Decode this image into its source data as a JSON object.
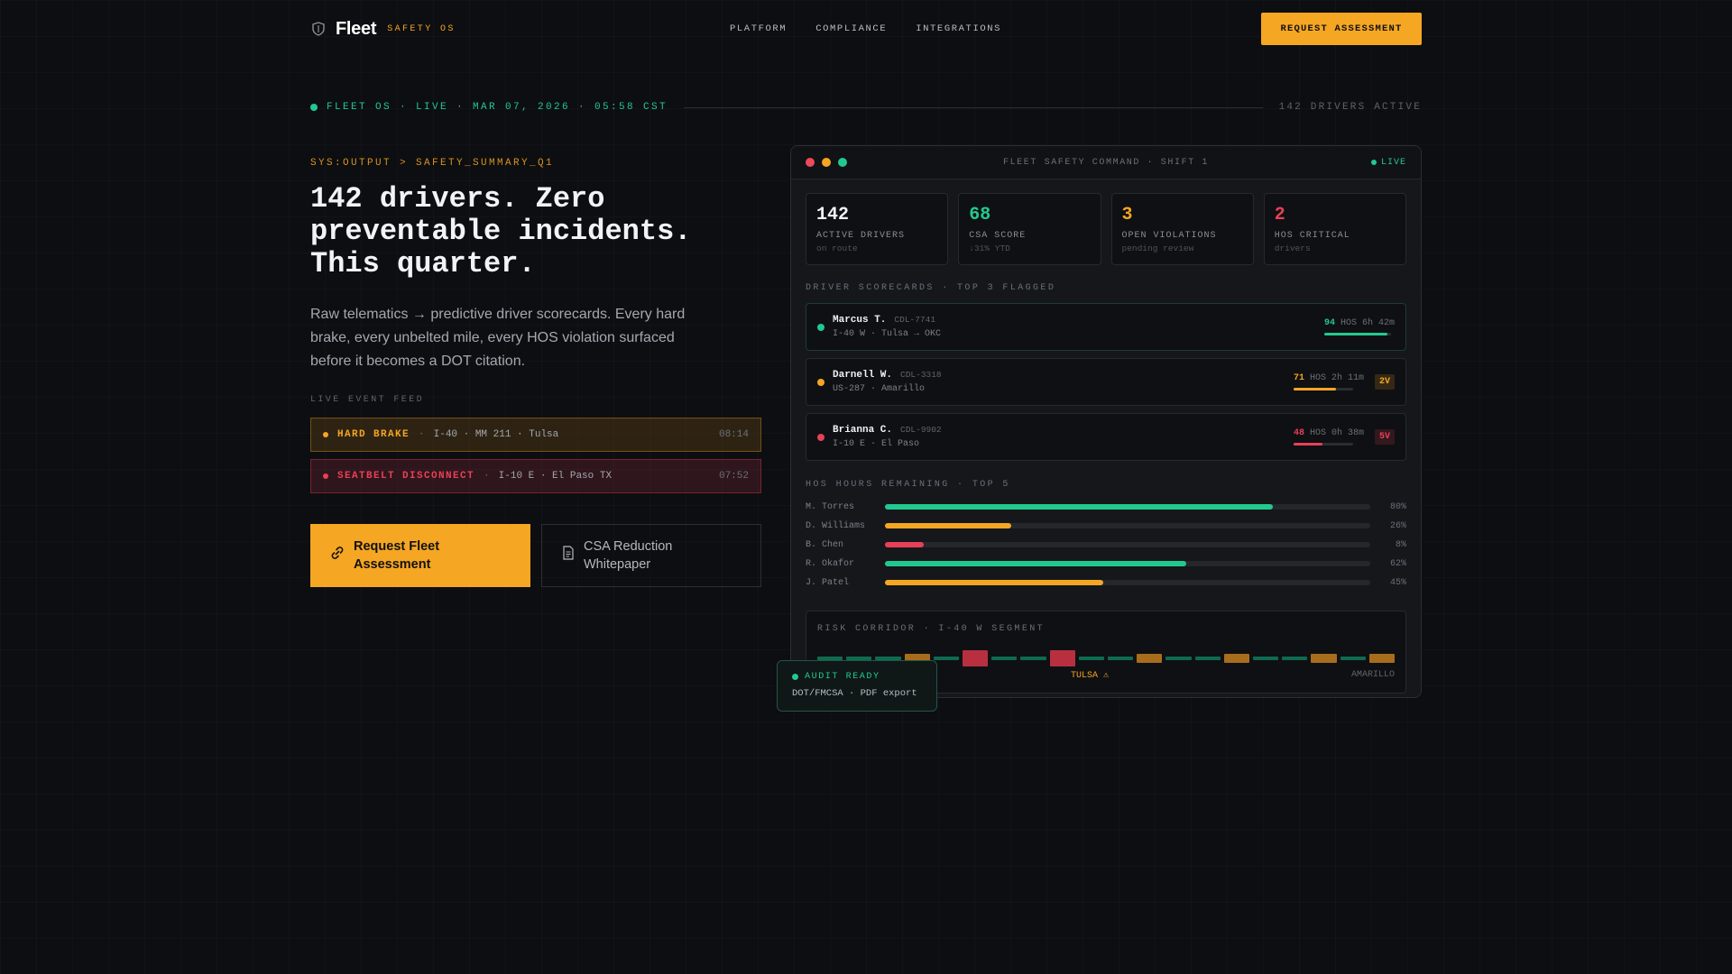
{
  "brand": {
    "name": "Fleet",
    "tagline": "SAFETY OS",
    "icon": "shield-icon"
  },
  "nav": {
    "links": [
      "PLATFORM",
      "COMPLIANCE",
      "INTEGRATIONS"
    ],
    "cta_label": "REQUEST ASSESSMENT"
  },
  "status": {
    "text": "FLEET OS · LIVE · MAR 07, 2026 · 05:58 CST",
    "right": "142 DRIVERS ACTIVE"
  },
  "hero": {
    "eyebrow": "SYS:OUTPUT > SAFETY_SUMMARY_Q1",
    "headline": "142 drivers. Zero preventable incidents. This quarter.",
    "lead": "Raw telematics → predictive driver scorecards. Every hard brake, every unbelted mile, every HOS violation surfaced before it becomes a DOT citation.",
    "feed_label": "LIVE EVENT FEED",
    "feed": [
      {
        "type": "HARD BRAKE",
        "location": "I-40 · MM 211 · Tulsa",
        "time": "08:14",
        "color": "#f5a623"
      },
      {
        "type": "SEATBELT DISCONNECT",
        "location": "I-10 E · El Paso TX",
        "time": "07:52",
        "color": "#e84057"
      }
    ],
    "cta_primary": "Request Fleet Assessment",
    "cta_secondary": "CSA Reduction Whitepaper"
  },
  "dashboard": {
    "title": "FLEET SAFETY COMMAND · SHIFT 1",
    "live": "LIVE",
    "kpis": [
      {
        "value": "142",
        "label": "ACTIVE DRIVERS",
        "sub": "on route",
        "color": "#f2f3f5"
      },
      {
        "value": "68",
        "label": "CSA SCORE",
        "sub": "↓31% YTD",
        "color": "#22c98f"
      },
      {
        "value": "3",
        "label": "OPEN VIOLATIONS",
        "sub": "pending review",
        "color": "#f5a623"
      },
      {
        "value": "2",
        "label": "HOS CRITICAL",
        "sub": "drivers",
        "color": "#e84057"
      }
    ],
    "scorecards_title": "DRIVER SCORECARDS · TOP 3 FLAGGED",
    "drivers": [
      {
        "name": "Marcus T.",
        "cdl": "CDL-7741",
        "route": "I-40 W · Tulsa → OKC",
        "score": "94",
        "hos": "HOS 6h 42m",
        "bar": 0.94,
        "badge": "",
        "color": "#22c98f"
      },
      {
        "name": "Darnell W.",
        "cdl": "CDL-3318",
        "route": "US-287 · Amarillo",
        "score": "71",
        "hos": "HOS 2h 11m",
        "bar": 0.71,
        "badge": "2V",
        "color": "#f5a623"
      },
      {
        "name": "Brianna C.",
        "cdl": "CDL-9902",
        "route": "I-10 E · El Paso",
        "score": "48",
        "hos": "HOS 0h 38m",
        "bar": 0.48,
        "badge": "5V",
        "color": "#e84057"
      }
    ],
    "hos_title": "HOS HOURS REMAINING · TOP 5",
    "hos": [
      {
        "name": "M. Torres",
        "pct": 80,
        "label": "80%",
        "color": "#22c98f"
      },
      {
        "name": "D. Williams",
        "pct": 26,
        "label": "26%",
        "color": "#f5a623"
      },
      {
        "name": "B. Chen",
        "pct": 8,
        "label": "8%",
        "color": "#e84057"
      },
      {
        "name": "R. Okafor",
        "pct": 62,
        "label": "62%",
        "color": "#22c98f"
      },
      {
        "name": "J. Patel",
        "pct": 45,
        "label": "45%",
        "color": "#f5a623"
      }
    ],
    "corridor_title": "RISK CORRIDOR · I-40 W SEGMENT",
    "corridor_levels": [
      "low",
      "low",
      "low",
      "med",
      "low",
      "high",
      "low",
      "low",
      "high",
      "low",
      "low",
      "med",
      "low",
      "low",
      "med",
      "low",
      "low",
      "med",
      "low",
      "med"
    ],
    "corridor_labels": {
      "mid": "TULSA ⚠",
      "end": "AMARILLO"
    }
  },
  "audit": {
    "title": "AUDIT READY",
    "sub": "DOT/FMCSA · PDF export"
  },
  "colors": {
    "accent": "#f5a623",
    "green": "#22c98f",
    "red": "#e84057"
  }
}
